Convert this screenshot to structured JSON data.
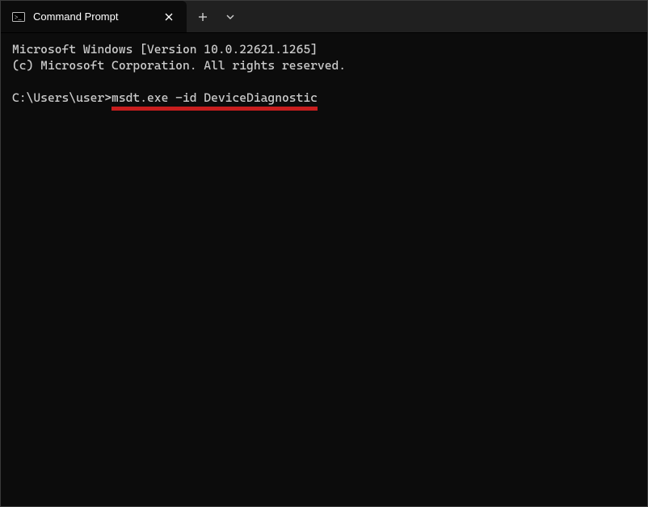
{
  "titlebar": {
    "tab_title": "Command Prompt",
    "app_icon_name": "cmd-icon",
    "close_glyph": "✕",
    "new_tab_glyph": "+",
    "dropdown_glyph": "⌄"
  },
  "terminal": {
    "banner_line_1": "Microsoft Windows [Version 10.0.22621.1265]",
    "banner_line_2": "(c) Microsoft Corporation. All rights reserved.",
    "prompt_prefix": "C:\\Users\\user>",
    "entered_command": "msdt.exe -id DeviceDiagnostic",
    "annotation": {
      "type": "underline",
      "color": "#c81e1e",
      "target": "entered_command"
    }
  }
}
